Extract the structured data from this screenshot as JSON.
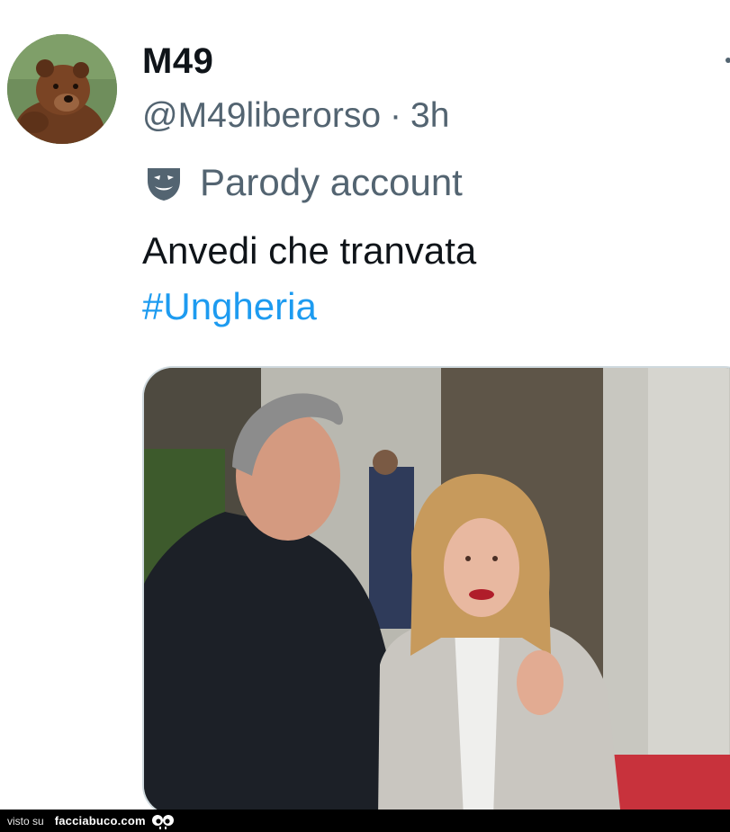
{
  "tweet": {
    "display_name": "M49",
    "handle": "@M49liberorso",
    "separator": "·",
    "time_ago": "3h",
    "label": "Parody account",
    "label_icon": "theater-mask-icon",
    "text": "Anvedi che tranvata",
    "hashtag": "#Ungheria",
    "hashtag_color": "#1d9bf0"
  },
  "footer": {
    "visto_label": "visto su",
    "brand": "facciabuco.com",
    "brand_icon": "eyes-icon"
  },
  "colors": {
    "text_primary": "#0f1419",
    "text_secondary": "#536471",
    "accent": "#1d9bf0"
  }
}
